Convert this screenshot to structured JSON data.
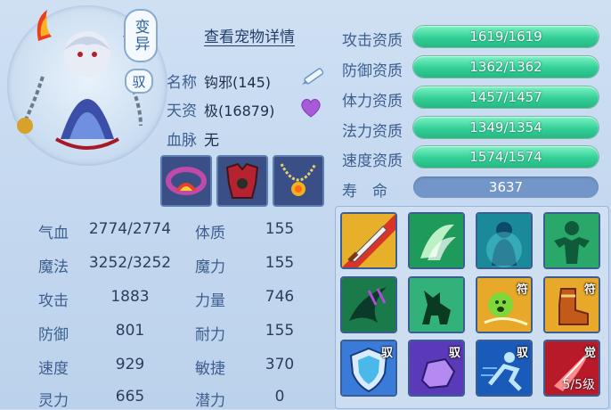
{
  "header": {
    "variant_badge": "变异",
    "tame_badge": "驭",
    "details_link": "查看宠物详情"
  },
  "info": {
    "name_label": "名称",
    "name_value": "钩邪(145)",
    "talent_label": "天资",
    "talent_value": "极(16879)",
    "bloodline_label": "血脉",
    "bloodline_value": "无"
  },
  "icons": {
    "edit": "pen-icon",
    "favorite": "heart-icon"
  },
  "equipment": [
    "bracelet",
    "armor",
    "necklace"
  ],
  "stats": {
    "hp_label": "气血",
    "hp_value": "2774/2774",
    "mp_label": "魔法",
    "mp_value": "3252/3252",
    "atk_label": "攻击",
    "atk_value": "1883",
    "def_label": "防御",
    "def_value": "801",
    "spd_label": "速度",
    "spd_value": "929",
    "spirit_label": "灵力",
    "spirit_value": "665",
    "con_label": "体质",
    "con_value": "155",
    "mag_label": "魔力",
    "mag_value": "155",
    "str_label": "力量",
    "str_value": "746",
    "end_label": "耐力",
    "end_value": "155",
    "agi_label": "敏捷",
    "agi_value": "370",
    "pot_label": "潜力",
    "pot_value": "0"
  },
  "aptitudes": [
    {
      "label": "攻击资质",
      "value": "1619/1619",
      "current": 1619,
      "max": 1619
    },
    {
      "label": "防御资质",
      "value": "1362/1362",
      "current": 1362,
      "max": 1362
    },
    {
      "label": "体力资质",
      "value": "1457/1457",
      "current": 1457,
      "max": 1457
    },
    {
      "label": "法力资质",
      "value": "1349/1354",
      "current": 1349,
      "max": 1354
    },
    {
      "label": "速度资质",
      "value": "1574/1574",
      "current": 1574,
      "max": 1574
    }
  ],
  "lifespan": {
    "label": "寿　命",
    "value": "3637"
  },
  "skills": {
    "tag_rune": "符",
    "tag_tame": "驭",
    "tag_awaken": "觉",
    "awaken_level": "5/5级"
  },
  "colors": {
    "aptitude_bar": "#34cf98",
    "lifespan_bar": "#7396c8",
    "background": "#c4d8ef"
  }
}
